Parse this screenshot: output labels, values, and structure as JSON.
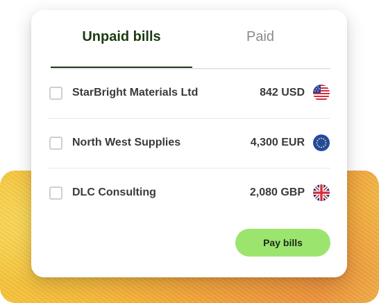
{
  "tabs": {
    "unpaid_label": "Unpaid bills",
    "paid_label": "Paid"
  },
  "bills": [
    {
      "name": "StarBright Materials Ltd",
      "amount": "842 USD",
      "flag": "us-flag-icon"
    },
    {
      "name": "North West Supplies",
      "amount": "4,300 EUR",
      "flag": "eu-flag-icon"
    },
    {
      "name": "DLC Consulting",
      "amount": "2,080 GBP",
      "flag": "uk-flag-icon"
    }
  ],
  "actions": {
    "pay_label": "Pay bills"
  },
  "colors": {
    "accent": "#9be56f",
    "tab_active": "#1c3a12",
    "text": "#3a3a3a",
    "muted": "#8a8a8a"
  }
}
